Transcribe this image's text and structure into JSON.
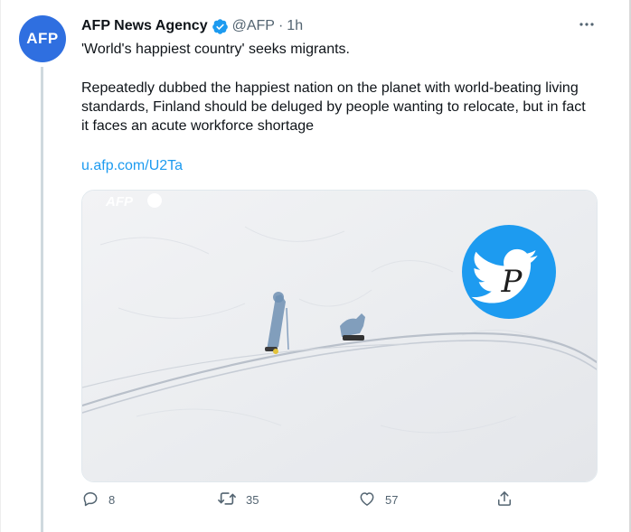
{
  "tweet": {
    "author_name": "AFP News Agency",
    "avatar_text": "AFP",
    "handle": "@AFP",
    "separator": "·",
    "time": "1h",
    "text_line1": "'World's happiest country' seeks migrants.",
    "text_body": "Repeatedly dubbed the happiest nation on the planet with world-beating living standards, Finland should be deluged by people wanting to relocate, but in fact it faces an acute workforce shortage",
    "link": "u.afp.com/U2Ta"
  },
  "media": {
    "watermark": "AFP",
    "overlay_logo_letter": "P"
  },
  "actions": {
    "reply_count": "8",
    "retweet_count": "35",
    "like_count": "57"
  },
  "colors": {
    "accent": "#1d9bf0",
    "avatar_bg": "#2f6fe0",
    "muted": "#536471"
  },
  "icons": [
    "verified-badge-icon",
    "more-icon",
    "reply-icon",
    "retweet-icon",
    "like-icon",
    "share-icon",
    "twitter-bird-icon"
  ]
}
